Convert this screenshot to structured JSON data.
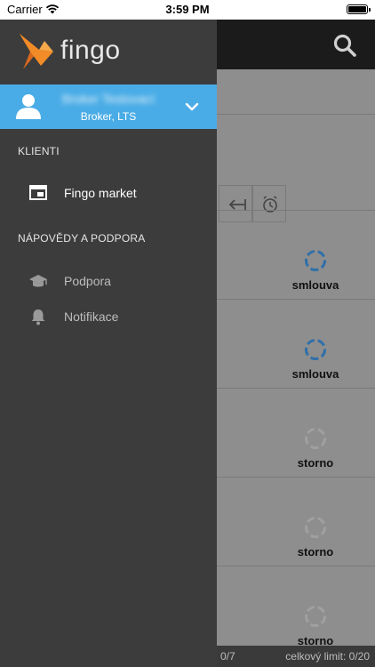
{
  "status_bar": {
    "carrier": "Carrier",
    "time": "3:59 PM"
  },
  "drawer": {
    "logo_text": "fingo",
    "user": {
      "name": "Broker Testovací",
      "role": "Broker, LTS"
    },
    "sections": {
      "clients_header": "KLIENTI",
      "help_header": "NÁPOVĚDY A PODPORA"
    },
    "items": {
      "market": {
        "label": "Fingo market",
        "icon": "window-icon"
      },
      "support": {
        "label": "Podpora",
        "icon": "graduation-cap-icon"
      },
      "notifications": {
        "label": "Notifikace",
        "icon": "bell-icon"
      }
    }
  },
  "background": {
    "statuses": [
      "smlouva",
      "smlouva",
      "storno",
      "storno",
      "storno"
    ],
    "footer_left": "0/7",
    "footer_right": "celkový limit: 0/20"
  },
  "colors": {
    "accent": "#4aace6",
    "brand_orange": "#f28c28",
    "drawer_bg": "#3c3c3c",
    "ring_blue": "#2f6fa8",
    "ring_gray": "#a0a0a0"
  }
}
